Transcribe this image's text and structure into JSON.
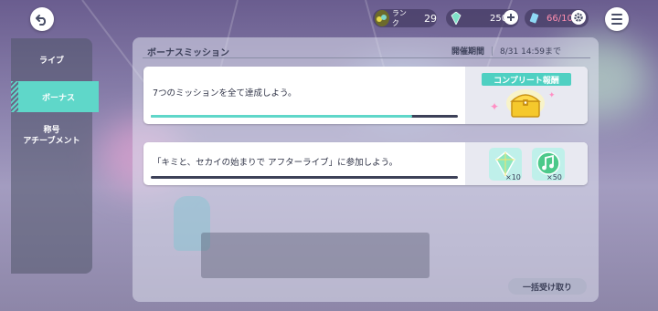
{
  "header": {
    "rank_label": "ランク",
    "rank_value": "29",
    "crystal_value": "2500",
    "ticket_value": "66/10"
  },
  "sidebar": {
    "items": [
      {
        "label": "ライブ"
      },
      {
        "label": "ボーナス"
      },
      {
        "label_line1": "称号",
        "label_line2": "アチーブメント"
      }
    ]
  },
  "panel": {
    "title": "ボーナスミッション",
    "period_label": "開催期間",
    "period_value": "8/31 14:59まで"
  },
  "missions": [
    {
      "text": "7つのミッションを全て達成しよう。",
      "progress": 0.85,
      "reward_label": "コンプリート報酬"
    },
    {
      "text": "「キミと、セカイの始まりで アフターライブ」に参加しよう。",
      "progress": 0.0,
      "rewards": [
        {
          "icon": "crystal-icon",
          "qty": "×10"
        },
        {
          "icon": "music-note-icon",
          "qty": "×50"
        }
      ]
    }
  ],
  "claim_all_label": "一括受け取り",
  "colors": {
    "accent": "#5fd7c9",
    "text_dark": "#3b3f58",
    "ticket": "#e0567d"
  }
}
